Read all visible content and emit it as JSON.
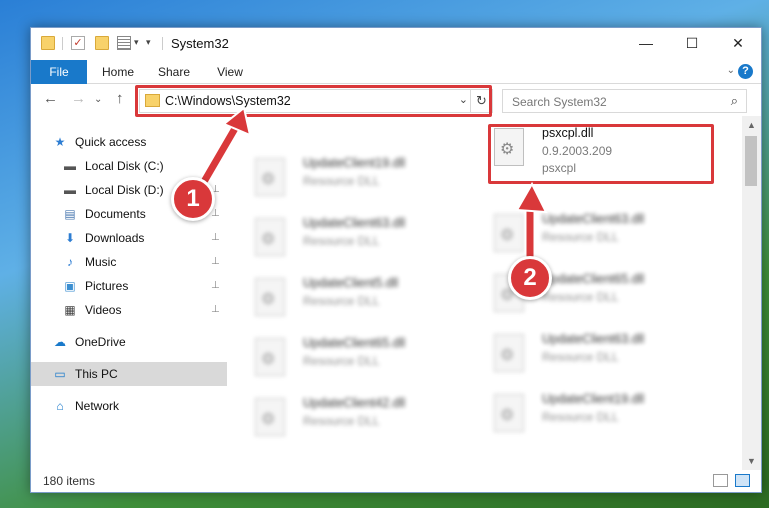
{
  "window": {
    "title": "System32",
    "controls": {
      "minimize": "—",
      "maximize": "☐",
      "close": "✕"
    }
  },
  "ribbon": {
    "tabs": [
      "File",
      "Home",
      "Share",
      "View"
    ],
    "expand_glyph": "⌄",
    "help_glyph": "?"
  },
  "nav": {
    "back": "←",
    "forward": "→",
    "recent": "⌄",
    "up": "↑",
    "address": "C:\\Windows\\System32",
    "address_dropdown": "⌄",
    "refresh": "↻",
    "search_placeholder": "Search System32",
    "search_glyph": "⌕"
  },
  "sidebar": {
    "items": [
      {
        "label": "Quick access",
        "icon": "star-icon",
        "glyph": "★",
        "color": "#2d7dd2",
        "pinned": false
      },
      {
        "label": "Local Disk (C:)",
        "icon": "drive-icon",
        "glyph": "▬",
        "color": "#555555",
        "pinned": false
      },
      {
        "label": "Local Disk (D:)",
        "icon": "drive-icon",
        "glyph": "▬",
        "color": "#555555",
        "pinned": true
      },
      {
        "label": "Documents",
        "icon": "document-icon",
        "glyph": "▤",
        "color": "#4a78b0",
        "pinned": true
      },
      {
        "label": "Downloads",
        "icon": "download-icon",
        "glyph": "⬇",
        "color": "#2d7dd2",
        "pinned": true
      },
      {
        "label": "Music",
        "icon": "music-icon",
        "glyph": "♪",
        "color": "#2d7dd2",
        "pinned": true
      },
      {
        "label": "Pictures",
        "icon": "picture-icon",
        "glyph": "▣",
        "color": "#3c8fd1",
        "pinned": true
      },
      {
        "label": "Videos",
        "icon": "video-icon",
        "glyph": "▦",
        "color": "#444444",
        "pinned": true
      },
      {
        "label": "OneDrive",
        "icon": "cloud-icon",
        "glyph": "☁",
        "color": "#1979ca",
        "pinned": false
      },
      {
        "label": "This PC",
        "icon": "computer-icon",
        "glyph": "▭",
        "color": "#1979ca",
        "pinned": false,
        "selected": true
      },
      {
        "label": "Network",
        "icon": "network-icon",
        "glyph": "⌂",
        "color": "#1979ca",
        "pinned": false
      }
    ],
    "pin_glyph": "📌"
  },
  "files": {
    "left_column": [
      {
        "name": "UpdateClient19.dll",
        "type": "Resource DLL"
      },
      {
        "name": "UpdateClient63.dll",
        "type": "Resource DLL"
      },
      {
        "name": "UpdateClient5.dll",
        "type": "Resource DLL"
      },
      {
        "name": "UpdateClient65.dll",
        "type": "Resource DLL"
      },
      {
        "name": "UpdateClient42.dll",
        "type": "Resource DLL"
      }
    ],
    "highlighted": {
      "name": "psxcpl.dll",
      "version": "0.9.2003.209",
      "description": "psxcpl"
    },
    "right_column": [
      {
        "name": "UpdateClient63.dll",
        "type": "Resource DLL"
      },
      {
        "name": "UpdateClient65.dll",
        "type": "Resource DLL"
      },
      {
        "name": "UpdateClient63.dll",
        "type": "Resource DLL"
      },
      {
        "name": "UpdateClient19.dll",
        "type": "Resource DLL"
      }
    ]
  },
  "status": {
    "items_count": "180 items"
  },
  "annotations": {
    "step1": "1",
    "step2": "2",
    "color": "#d9383a"
  }
}
